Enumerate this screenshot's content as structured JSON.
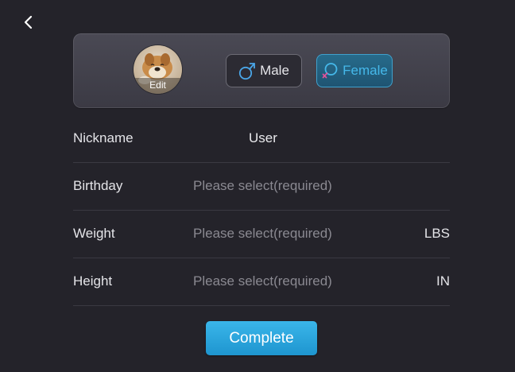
{
  "header": {
    "back_icon": "chevron-left-icon"
  },
  "profile": {
    "avatar_edit_label": "Edit",
    "gender_options": [
      {
        "label": "Male",
        "icon": "male-symbol-icon",
        "selected": false
      },
      {
        "label": "Female",
        "icon": "female-symbol-icon",
        "selected": true
      }
    ]
  },
  "form": {
    "rows": [
      {
        "label": "Nickname",
        "value": "User",
        "unit": ""
      },
      {
        "label": "Birthday",
        "placeholder": "Please select(required)",
        "unit": ""
      },
      {
        "label": "Weight",
        "placeholder": "Please select(required)",
        "unit": "LBS"
      },
      {
        "label": "Height",
        "placeholder": "Please select(required)",
        "unit": "IN"
      }
    ]
  },
  "actions": {
    "complete_label": "Complete"
  },
  "colors": {
    "background": "#24232a",
    "accent": "#2aa8e0",
    "female_accent": "#45b8ea",
    "male_accent": "#4aa6e8"
  }
}
